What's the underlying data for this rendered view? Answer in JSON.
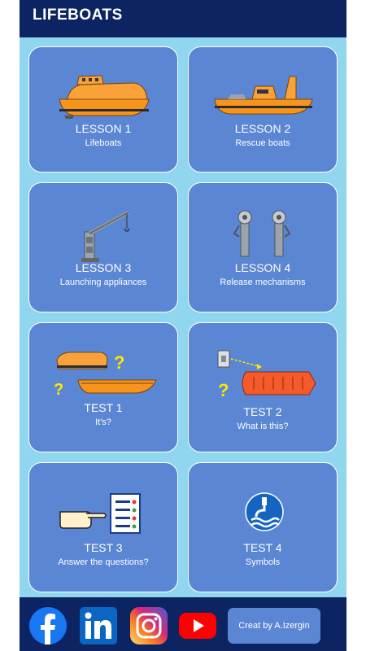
{
  "app": {
    "title": "LIFEBOATS"
  },
  "cards": [
    {
      "title": "LESSON 1",
      "subtitle": "Lifeboats"
    },
    {
      "title": "LESSON 2",
      "subtitle": "Rescue boats"
    },
    {
      "title": "LESSON 3",
      "subtitle": "Launching appliances"
    },
    {
      "title": "LESSON 4",
      "subtitle": "Release mechanisms"
    },
    {
      "title": "TEST 1",
      "subtitle": "It's?"
    },
    {
      "title": "TEST 2",
      "subtitle": "What is this?"
    },
    {
      "title": "TEST 3",
      "subtitle": "Answer the questions?"
    },
    {
      "title": "TEST 4",
      "subtitle": "Symbols"
    }
  ],
  "footer": {
    "social_icons": [
      "facebook-icon",
      "linkedin-icon",
      "instagram-icon",
      "youtube-icon"
    ],
    "credit": "Creat by A.Izergin"
  },
  "colors": {
    "appbar": "#0c2462",
    "background": "#8fd6ee",
    "card": "#5b86d3",
    "boat_orange": "#f7941d",
    "question_yellow": "#ffe600"
  }
}
